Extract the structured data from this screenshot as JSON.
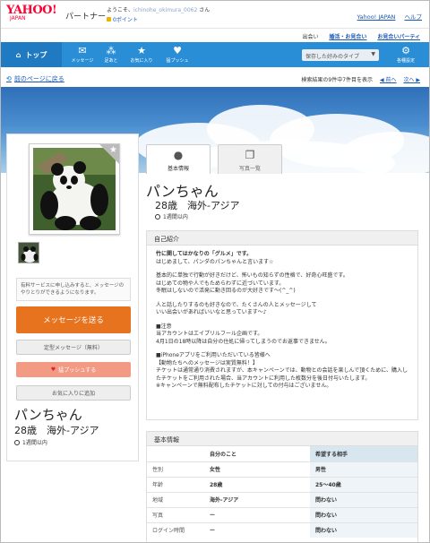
{
  "header": {
    "logo": "YAHOO!",
    "logo_sub": "JAPAN",
    "brand": "パートナー",
    "welcome_prefix": "ようこそ、",
    "username": "ichinohe_okimura_0062",
    "welcome_suffix": " さん",
    "points": "0ポイント",
    "links": [
      "Yahoo! JAPAN",
      "ヘルプ"
    ]
  },
  "subnav": {
    "label": "出会い",
    "links": [
      "婚活・お見合い",
      "お見合いパーティ"
    ]
  },
  "nav": {
    "top": "トップ",
    "items": [
      {
        "icon": "mail-icon",
        "glyph": "✉",
        "label": "メッセージ"
      },
      {
        "icon": "footprint-icon",
        "glyph": "👣",
        "label": "足あと"
      },
      {
        "icon": "star-icon",
        "glyph": "★",
        "label": "お気に入り"
      },
      {
        "icon": "heart-icon",
        "glyph": "♥",
        "label": "猛プッシュ"
      }
    ],
    "select_value": "保存した好みのタイプ",
    "settings_label": "各種設定"
  },
  "backbar": {
    "back_label": "前のページに戻る",
    "result_text": "検索結果の9件中7件目を表示",
    "prev_label": "前へ",
    "next_label": "次へ"
  },
  "profile": {
    "name": "パンちゃん",
    "age_region": "28歳　海外-アジア",
    "last_login": "1週間以内",
    "notice": "有料サービスに申し込みすると、メッセージのやりとりができるようになります。",
    "buttons": {
      "send_message": "メッセージを送る",
      "template_message": "定型メッセージ（無料）",
      "push": "猛プッシュする",
      "add_favorite": "お気に入りに追加"
    }
  },
  "tabs": [
    {
      "label": "基本情報",
      "icon": "person-icon"
    },
    {
      "label": "写真一覧",
      "icon": "photos-icon"
    }
  ],
  "intro": {
    "heading": "自己紹介",
    "headline": "竹に関してはかなりの「グルメ」です。",
    "paragraphs": [
      "はじめまして、パンダのパンちゃんと言います☆",
      "基本的に単独で行動が好きだけど、怖いもの知らずの性格で、好奇心旺盛です。\nはじめての物や人でもためらわずに近づいています。\n冬眠はしないので活発に動き回るのが大好きです〜(^_^)",
      "人と話したりするのも好きなので、たくさんの人とメッセージして\nいい出会いがあればいいなと思っています〜♪",
      "■注意\n当アカウントはエイプリルフール企画です。\n4月1日の18時以降は自分の住処に帰ってしまうのでお返事できません。",
      "■iPhoneアプリをご利用いただいている皆様へ\n【動物たちへのメッセージは実質無料！】\nチケットは通常通り消費されますが、本キャンペーンでは、動物との会話を楽しんで頂くために、購入したチケットをご利用された場合、当アカウントに利用した枚数分を後日付与いたします。\n※キャンペーンで無料配布したチケットに対しての付与はございません。"
    ]
  },
  "basic_info": {
    "heading": "基本情報",
    "col_self": "自分のこと",
    "col_want": "希望する相手",
    "rows": [
      {
        "label": "性別",
        "self": "女性",
        "want": "男性"
      },
      {
        "label": "年齢",
        "self": "28歳",
        "want": "25〜40歳"
      },
      {
        "label": "地域",
        "self": "海外-アジア",
        "want": "問わない"
      },
      {
        "label": "写真",
        "self": "ー",
        "want": "問わない"
      },
      {
        "label": "ログイン時間",
        "self": "ー",
        "want": "問わない"
      }
    ]
  },
  "colors": {
    "brand_red": "#ff0033",
    "nav_blue": "#2a8ed6",
    "message_button": "#e8731f",
    "push_button": "#f39a84",
    "link_blue": "#1a58b8"
  }
}
